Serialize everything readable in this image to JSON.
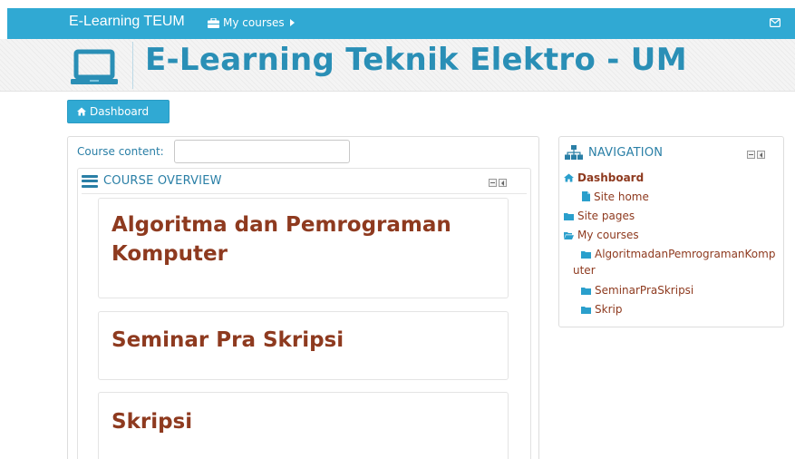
{
  "navbar": {
    "brand": "E-Learning TEUM",
    "my_courses": "My courses",
    "icons": {
      "briefcase": "briefcase-icon",
      "caret": "caret-right-icon",
      "mail": "envelope-icon"
    }
  },
  "header": {
    "title": "E-Learning Teknik Elektro - UM",
    "logo_icon": "laptop-icon"
  },
  "dashboard_button": {
    "label": "Dashboard",
    "icon": "home-icon"
  },
  "course_content": {
    "label": "Course content:",
    "value": "",
    "placeholder": ""
  },
  "course_overview": {
    "title": "COURSE OVERVIEW",
    "courses": [
      {
        "title_line1": "Algoritma dan Pemrograman",
        "title_line2": "Komputer"
      },
      {
        "title_line1": "Seminar Pra Skripsi"
      },
      {
        "title_line1": "Skripsi"
      }
    ]
  },
  "navigation": {
    "title": "NAVIGATION",
    "items": [
      {
        "label": "Dashboard",
        "icon": "home-icon"
      },
      {
        "label": "Site home",
        "icon": "file-icon"
      },
      {
        "label": "Site pages",
        "icon": "folder-icon"
      },
      {
        "label": "My courses",
        "icon": "folder-open-icon"
      },
      {
        "label_line1": "AlgoritmadanPemrogramanKomp",
        "label_line2": "uter",
        "icon": "folder-icon"
      },
      {
        "label": "SeminarPraSkripsi",
        "icon": "folder-icon"
      },
      {
        "label": "Skrip",
        "icon": "folder-icon"
      }
    ]
  },
  "colors": {
    "navbar": "#30a9d3",
    "title": "#2a8fb6",
    "link": "#8e3a1f",
    "heading": "#2a7fa6"
  }
}
